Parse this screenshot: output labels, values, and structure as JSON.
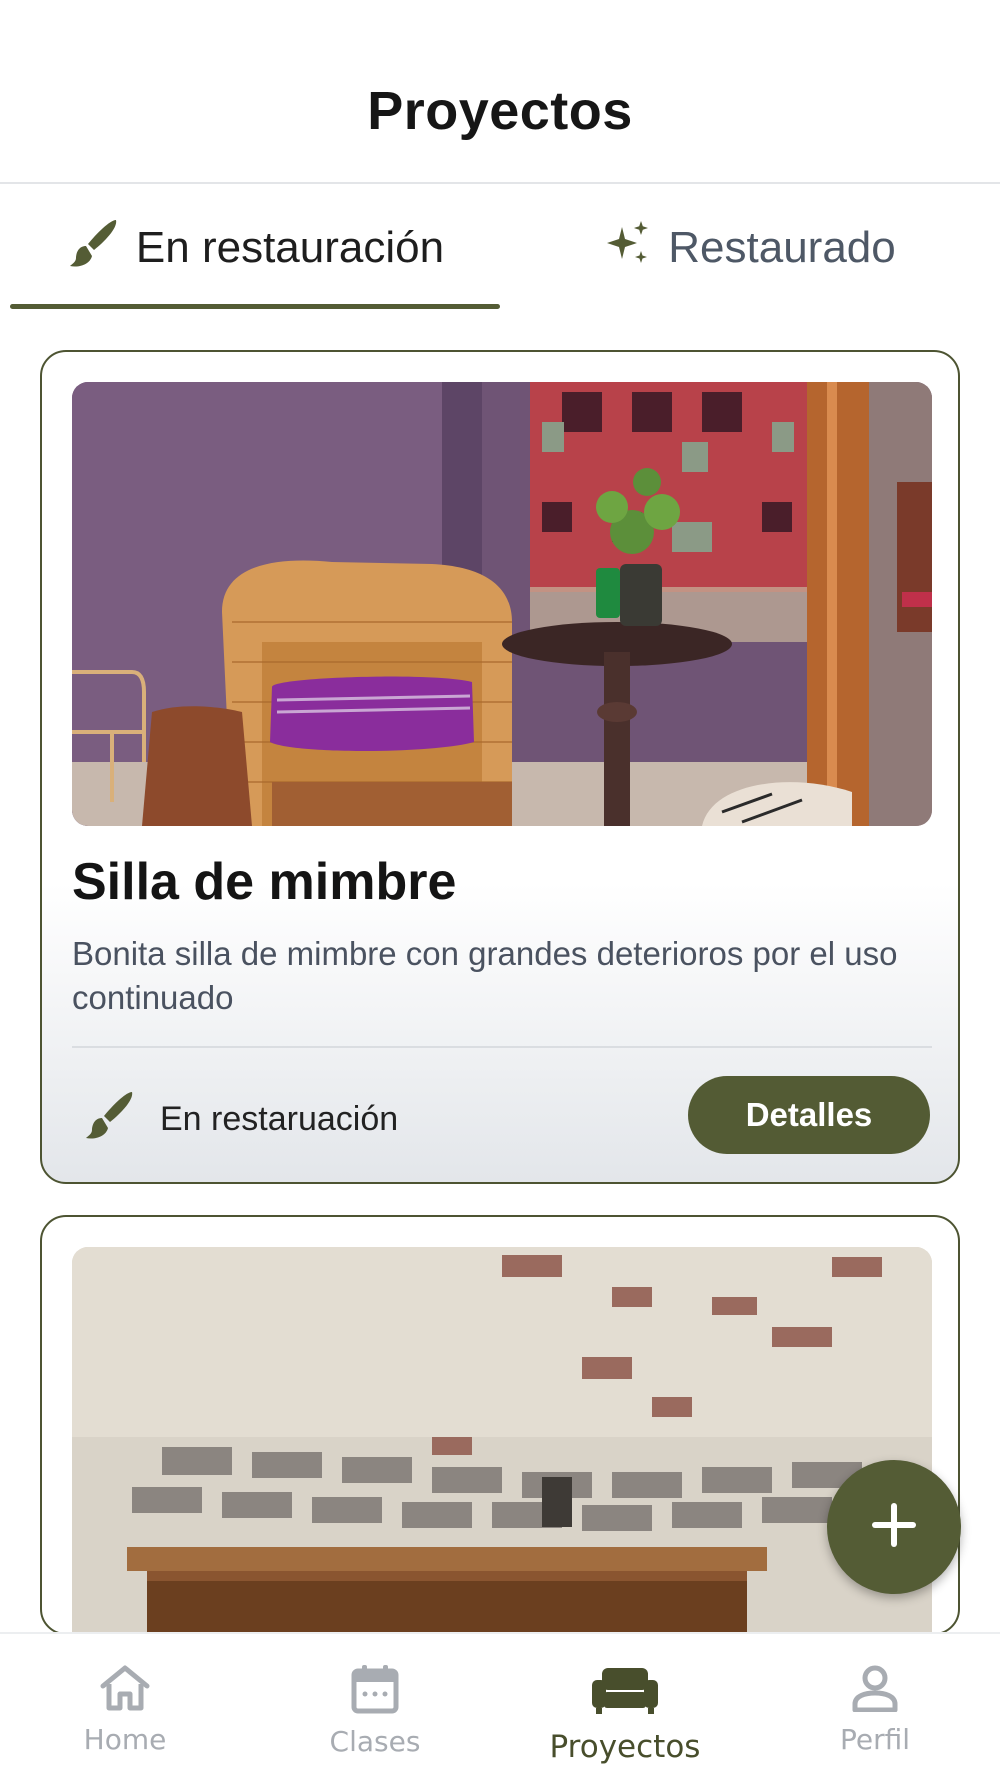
{
  "header": {
    "title": "Proyectos"
  },
  "tabs": [
    {
      "label": "En restauración",
      "icon": "paintbrush-icon",
      "active": true
    },
    {
      "label": "Restaurado",
      "icon": "sparkles-icon",
      "active": false
    }
  ],
  "projects": [
    {
      "title": "Silla de mimbre",
      "description": "Bonita silla de mimbre con grandes deterioros por el uso continuado",
      "status": "En restaruación",
      "status_icon": "paintbrush-icon",
      "button_label": "Detalles"
    }
  ],
  "fab": {
    "icon": "plus-icon"
  },
  "bottom_nav": [
    {
      "label": "Home",
      "icon": "home-icon",
      "active": false
    },
    {
      "label": "Clases",
      "icon": "calendar-icon",
      "active": false
    },
    {
      "label": "Proyectos",
      "icon": "sofa-icon",
      "active": true
    },
    {
      "label": "Perfil",
      "icon": "person-icon",
      "active": false
    }
  ],
  "colors": {
    "accent": "#545c35",
    "text_muted": "#4e5866",
    "nav_inactive": "#a8acb2"
  }
}
